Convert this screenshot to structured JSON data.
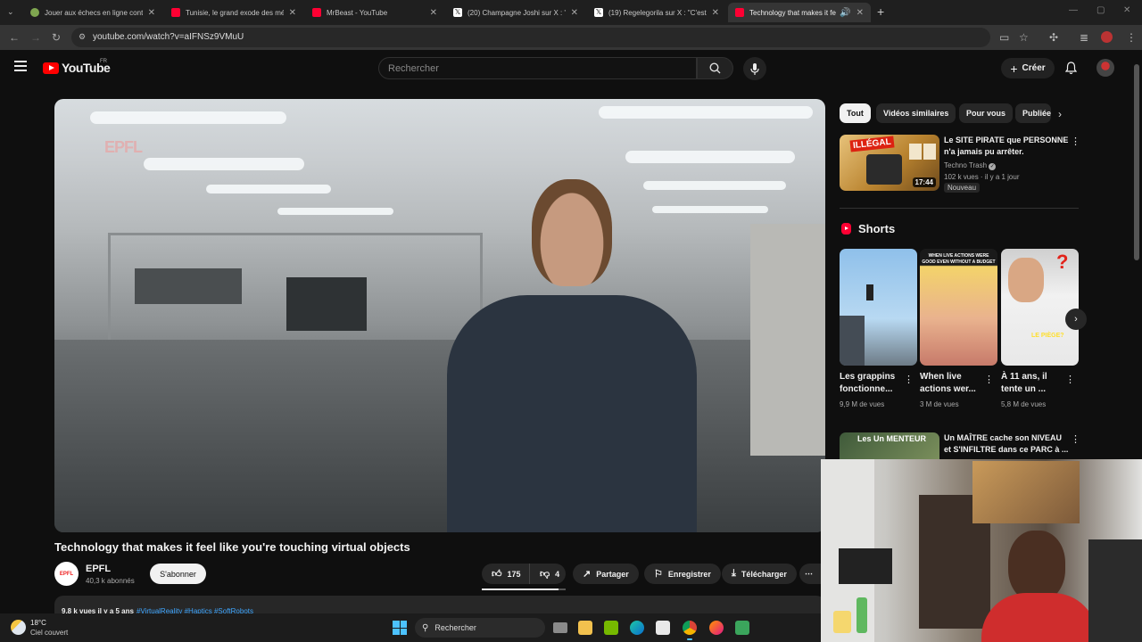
{
  "browser": {
    "tabs": [
      {
        "label": "Jouer aux échecs en ligne contre",
        "color": "#7fa650"
      },
      {
        "label": "Tunisie, le grand exode des médecins",
        "color": "#ff0033"
      },
      {
        "label": "MrBeast - YouTube",
        "color": "#ff0033"
      },
      {
        "label": "(20) Champagne Joshi sur X : \"Il",
        "color": "#000000"
      },
      {
        "label": "(19) Regelegorila sur X : \"C'est",
        "color": "#000000"
      },
      {
        "label": "Technology that makes it fe",
        "color": "#ff0033"
      }
    ],
    "url": "youtube.com/watch?v=aIFNSz9VMuU"
  },
  "header": {
    "logo": "YouTube",
    "country": "FR",
    "search_placeholder": "Rechercher",
    "create_label": "Créer"
  },
  "player": {
    "watermark": "EPFL"
  },
  "video": {
    "title": "Technology that makes it feel like you're touching virtual objects",
    "channel": "EPFL",
    "channel_avatar_text": "EPFL",
    "subscribers": "40,3 k abonnés",
    "subscribe_label": "S'abonner",
    "likes": "175",
    "dislikes": "4",
    "share_label": "Partager",
    "save_label": "Enregistrer",
    "download_label": "Télécharger",
    "meta": "9,8 k vues  il y a 5 ans",
    "tags": "#VirtualReality #Haptics #SoftRobots"
  },
  "sidebar": {
    "chips": [
      "Tout",
      "Vidéos similaires",
      "Pour vous",
      "Publiées"
    ],
    "recommendations": [
      {
        "title": "Le SITE PIRATE que PERSONNE n'a jamais pu arrêter.",
        "channel": "Techno Trash",
        "views": "102 k vues",
        "age": "il y a 1 jour",
        "duration": "17:44",
        "badge": "Nouveau",
        "thumb_text": "ILLÉGAL"
      },
      {
        "title": "Un MAÎTRE cache son NIVEAU et S'INFILTRE dans ce PARC à ...",
        "thumb_text": "Les Un MENTEUR"
      }
    ],
    "shorts_heading": "Shorts",
    "shorts": [
      {
        "title": "Les grappins fonctionne...",
        "views": "9,9 M de vues"
      },
      {
        "title": "When live actions wer...",
        "views": "3 M de vues",
        "overlay": "WHEN LIVE ACTIONS WERE GOOD EVEN WITHOUT A BUDGET"
      },
      {
        "title": "À 11 ans, il tente un ...",
        "views": "5,8 M de vues",
        "overlay": "LE PIÈGE?"
      }
    ]
  },
  "taskbar": {
    "temperature": "18°C",
    "weather": "Ciel couvert",
    "search_label": "Rechercher"
  }
}
